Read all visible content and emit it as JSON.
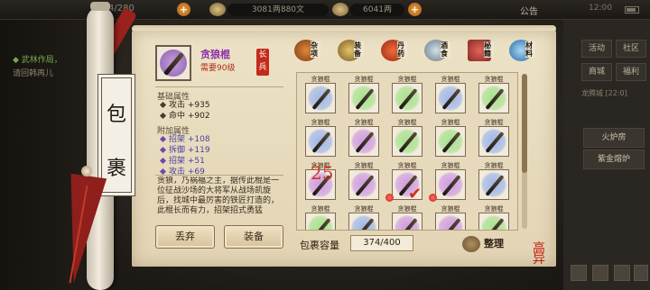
{
  "topbar": {
    "level_text": "4/280",
    "copper": "3081两880文",
    "silver": "6041两",
    "notice": "公告",
    "clock": "12:00"
  },
  "left": {
    "quest_line1": "武林作局，",
    "quest_line2": "请回韩再儿"
  },
  "right": {
    "btn_huodong": "活动",
    "btn_shehui": "社区",
    "btn_shangcheng": "商城",
    "btn_fuli": "福利",
    "label_weiwang": "龙腾城",
    "label_weiwang_val": "[22:0]",
    "btn_huolu": "火炉房",
    "btn_zijin": "紫金熔炉"
  },
  "scroll": {
    "title_top": "包",
    "title_bottom": "裹"
  },
  "detail": {
    "item_name": "贪狼棍",
    "requirement": "需要90级",
    "weapon_type": "长兵",
    "base_title": "基础属性",
    "base_attrs": [
      {
        "label": "攻击",
        "value": "+935"
      },
      {
        "label": "命中",
        "value": "+902"
      }
    ],
    "extra_title": "附加属性",
    "extra_attrs": [
      {
        "label": "招架",
        "value": "+108"
      },
      {
        "label": "拆御",
        "value": "+119"
      },
      {
        "label": "招架",
        "value": "+51"
      },
      {
        "label": "攻击",
        "value": "+69"
      }
    ],
    "description": "贪狼，乃祸福之主，据传此棍是一位征战沙场的大将军从战场凯旋后，找城中最厉害的铁匠打造的，此棍长而有力，招架招式勇猛"
  },
  "buttons": {
    "discard": "丢弃",
    "equip": "装备"
  },
  "categories": [
    {
      "label": "杂项"
    },
    {
      "label": "装备"
    },
    {
      "label": "丹药"
    },
    {
      "label": "酒食"
    },
    {
      "label": "秘籍"
    },
    {
      "label": "材料"
    }
  ],
  "grid": {
    "item_label": "贪狼棍",
    "overlay_number": "25"
  },
  "footer": {
    "capacity_label": "包裹容量",
    "capacity_value": "374/400",
    "sort_label": "整理"
  },
  "seal_text": "高异",
  "colors": {
    "blue_glow": "#9eb6e8",
    "green_glow": "#a6e28c",
    "purple_glow": "#cf9ae0",
    "red_pin": "#d42a1a",
    "parchment": "#e8dcbf"
  }
}
